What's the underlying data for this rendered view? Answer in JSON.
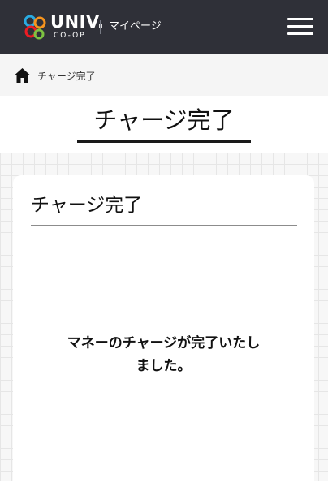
{
  "header": {
    "logo_word": "UNIV.",
    "logo_sub": "CO-OP",
    "section_label": "マイページ",
    "menu_icon": "hamburger-menu-icon"
  },
  "breadcrumb": {
    "home_icon": "home-icon",
    "current": "チャージ完了"
  },
  "page": {
    "title": "チャージ完了"
  },
  "card": {
    "title": "チャージ完了",
    "message_line1": "マネーのチャージが完了いたし",
    "message_line2": "ました。"
  },
  "colors": {
    "header_bg": "#2f3038",
    "breadcrumb_bg": "#f5f5f5",
    "grid_bg": "#f7f7f7",
    "logo_green": "#7dc242",
    "logo_orange": "#f7941d",
    "logo_blue": "#29abe2",
    "logo_red": "#ed1c24"
  }
}
